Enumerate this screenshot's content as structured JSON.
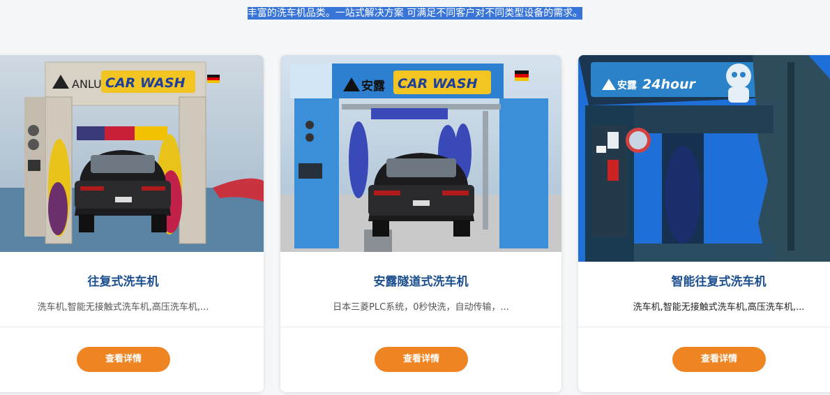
{
  "intro": {
    "tagline": "丰富的洗车机品类。一站式解决方案 可满足不同客户对不同类型设备的需求。"
  },
  "products": [
    {
      "brand": "ANLU",
      "logo_text": "CAR WASH",
      "title": "往复式洗车机",
      "description": "洗车机,智能无接触式洗车机,高压洗车机,...",
      "button_label": "查看详情"
    },
    {
      "brand": "安露",
      "logo_text": "CAR WASH",
      "title": "安露隧道式洗车机",
      "description": "日本三菱PLC系统，0秒快洗，自动传输，...",
      "button_label": "查看详情"
    },
    {
      "brand": "安露",
      "logo_text": "24hour",
      "title": "智能往复式洗车机",
      "description": "洗车机,智能无接触式洗车机,高压洗车机,...",
      "button_label": "查看详情"
    }
  ],
  "colors": {
    "accent_button": "#ef8422",
    "title_blue": "#1c4f8e",
    "selection_highlight": "#3875d7"
  }
}
